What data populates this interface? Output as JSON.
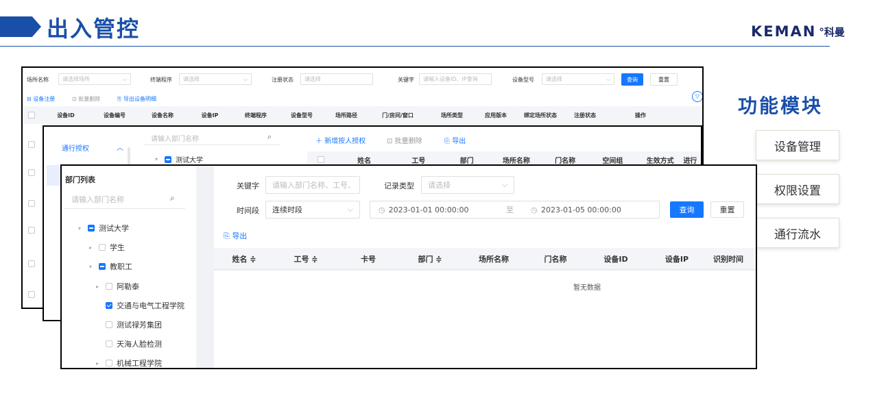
{
  "header": {
    "title": "出入管控",
    "logo_mark": "KEMAN",
    "logo_cn": "°科曼"
  },
  "module": {
    "title": "功能模块",
    "items": [
      "设备管理",
      "权限设置",
      "通行流水"
    ]
  },
  "device_panel": {
    "filters": {
      "site_label": "场所名称",
      "site_placeholder": "请选择场所",
      "terminal_label": "终端程序",
      "terminal_placeholder": "请选择",
      "reg_label": "注册状态",
      "reg_placeholder": "请选择",
      "keyword_label": "关键字",
      "keyword_placeholder": "请输入设备ID、IP查询",
      "model_label": "设备型号",
      "model_placeholder": "请选择",
      "query": "查询",
      "reset": "重置"
    },
    "actions": [
      "设备注册",
      "批量删除",
      "导出设备明细"
    ],
    "columns": [
      "设备ID",
      "设备编号",
      "设备名称",
      "设备IP",
      "终端程序",
      "设备型号",
      "场所路径",
      "门/房间/窗口",
      "场所类型",
      "应用版本",
      "绑定场所状态",
      "注册状态",
      "操作"
    ]
  },
  "auth_panel": {
    "menu_item": "通行授权",
    "search_placeholder": "请输入部门名称",
    "tree_root": "测试大学",
    "actions": [
      "新增按人授权",
      "批量删除",
      "导出"
    ],
    "columns": [
      "姓名",
      "工号",
      "部门",
      "场所名称",
      "门名称",
      "空间组",
      "生效方式",
      "进行"
    ]
  },
  "record_panel": {
    "dept_title": "部门列表",
    "dept_search_placeholder": "请输入部门名称",
    "tree": [
      {
        "label": "测试大学",
        "level": 0,
        "state": "partial",
        "caret": "open"
      },
      {
        "label": "学生",
        "level": 1,
        "state": "off",
        "caret": "closed"
      },
      {
        "label": "教职工",
        "level": 1,
        "state": "partial",
        "caret": "open"
      },
      {
        "label": "阿勒泰",
        "level": 2,
        "state": "off",
        "caret": "closed"
      },
      {
        "label": "交通与电气工程学院",
        "level": 2,
        "state": "on",
        "caret": "none"
      },
      {
        "label": "测试禄芳集团",
        "level": 2,
        "state": "off",
        "caret": "none"
      },
      {
        "label": "天海人脸检测",
        "level": 2,
        "state": "off",
        "caret": "none"
      },
      {
        "label": "机械工程学院",
        "level": 2,
        "state": "off",
        "caret": "closed"
      }
    ],
    "keyword_label": "关键字",
    "keyword_placeholder": "请输入部门名称、工号、",
    "type_label": "记录类型",
    "type_placeholder": "请选择",
    "period_label": "时间段",
    "period_value": "连续时段",
    "start_time": "2023-01-01 00:00:00",
    "to": "至",
    "end_time": "2023-01-05 00:00:00",
    "query": "查询",
    "reset": "重置",
    "export": "导出",
    "columns": [
      "姓名 ≑",
      "工号 ≑",
      "卡号",
      "部门 ≑",
      "场所名称",
      "门名称",
      "设备ID",
      "设备IP",
      "识别时间"
    ],
    "empty": "暂无数据"
  }
}
